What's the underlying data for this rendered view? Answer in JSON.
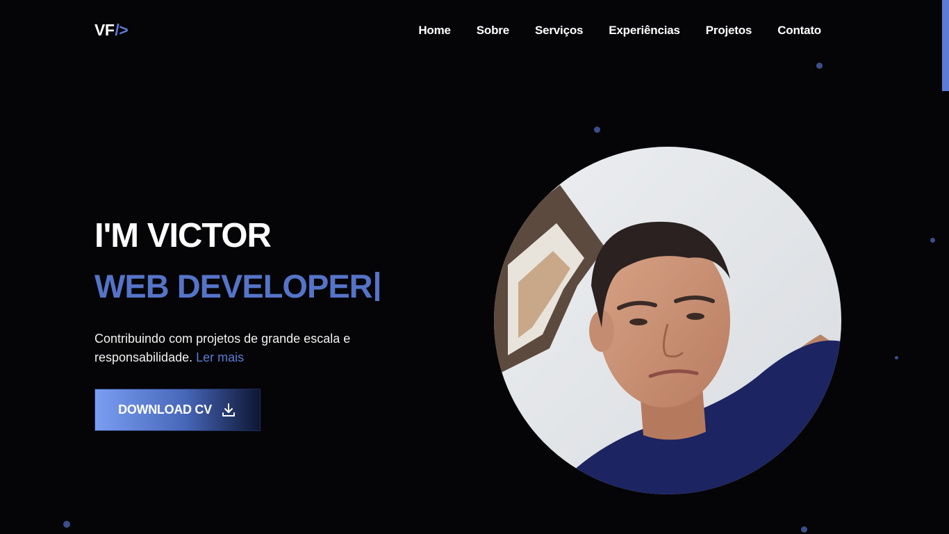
{
  "header": {
    "logo_text": "VF",
    "logo_mark": "/>",
    "nav": [
      "Home",
      "Sobre",
      "Serviços",
      "Experiências",
      "Projetos",
      "Contato"
    ]
  },
  "hero": {
    "name": "I'M VICTOR",
    "role": "WEB DEVELOPER",
    "description": "Contribuindo com projetos de grande escala e responsabilidade.",
    "read_more": "Ler mais",
    "download_label": "DOWNLOAD CV",
    "download_icon": "download-icon"
  },
  "colors": {
    "background": "#050507",
    "accent": "#5574c8",
    "particle": "#3a4e8c"
  },
  "portrait": {
    "icon": "profile-photo"
  }
}
